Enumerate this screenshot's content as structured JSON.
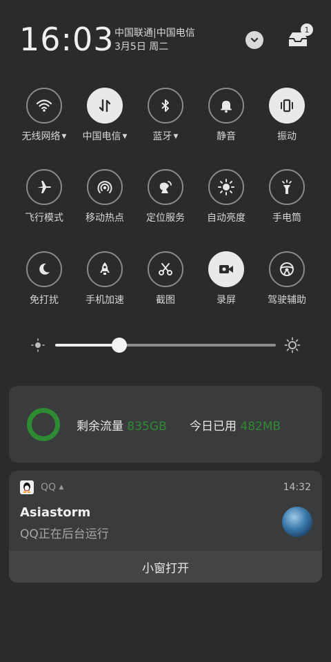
{
  "status": {
    "time": "16:03",
    "carrier": "中国联通|中国电信",
    "date": "3月5日 周二",
    "badge_count": "1"
  },
  "tiles": [
    {
      "label": "无线网络",
      "icon": "wifi-icon",
      "on": false,
      "dropdown": true
    },
    {
      "label": "中国电信",
      "icon": "mobile-data-icon",
      "on": true,
      "dropdown": true
    },
    {
      "label": "蓝牙",
      "icon": "bluetooth-icon",
      "on": false,
      "dropdown": true
    },
    {
      "label": "静音",
      "icon": "bell-icon",
      "on": false,
      "dropdown": false
    },
    {
      "label": "振动",
      "icon": "vibrate-icon",
      "on": true,
      "dropdown": false
    },
    {
      "label": "飞行模式",
      "icon": "airplane-icon",
      "on": false,
      "dropdown": false
    },
    {
      "label": "移动热点",
      "icon": "hotspot-icon",
      "on": false,
      "dropdown": false
    },
    {
      "label": "定位服务",
      "icon": "location-icon",
      "on": false,
      "dropdown": false
    },
    {
      "label": "自动亮度",
      "icon": "auto-brightness-icon",
      "on": false,
      "dropdown": false
    },
    {
      "label": "手电筒",
      "icon": "flashlight-icon",
      "on": false,
      "dropdown": false
    },
    {
      "label": "免打扰",
      "icon": "moon-icon",
      "on": false,
      "dropdown": false
    },
    {
      "label": "手机加速",
      "icon": "rocket-icon",
      "on": false,
      "dropdown": false
    },
    {
      "label": "截图",
      "icon": "scissors-icon",
      "on": false,
      "dropdown": false
    },
    {
      "label": "录屏",
      "icon": "video-icon",
      "on": true,
      "dropdown": false
    },
    {
      "label": "驾驶辅助",
      "icon": "steering-wheel-icon",
      "on": false,
      "dropdown": false
    }
  ],
  "brightness": {
    "level": 0.29
  },
  "data_usage": {
    "remaining_label": "剩余流量",
    "remaining_value": "835GB",
    "today_label": "今日已用",
    "today_value": "482MB",
    "ring_color": "#2f8a34"
  },
  "notification": {
    "app": "QQ",
    "time": "14:32",
    "title": "Asiastorm",
    "body": "QQ正在后台运行",
    "action": "小窗打开"
  }
}
